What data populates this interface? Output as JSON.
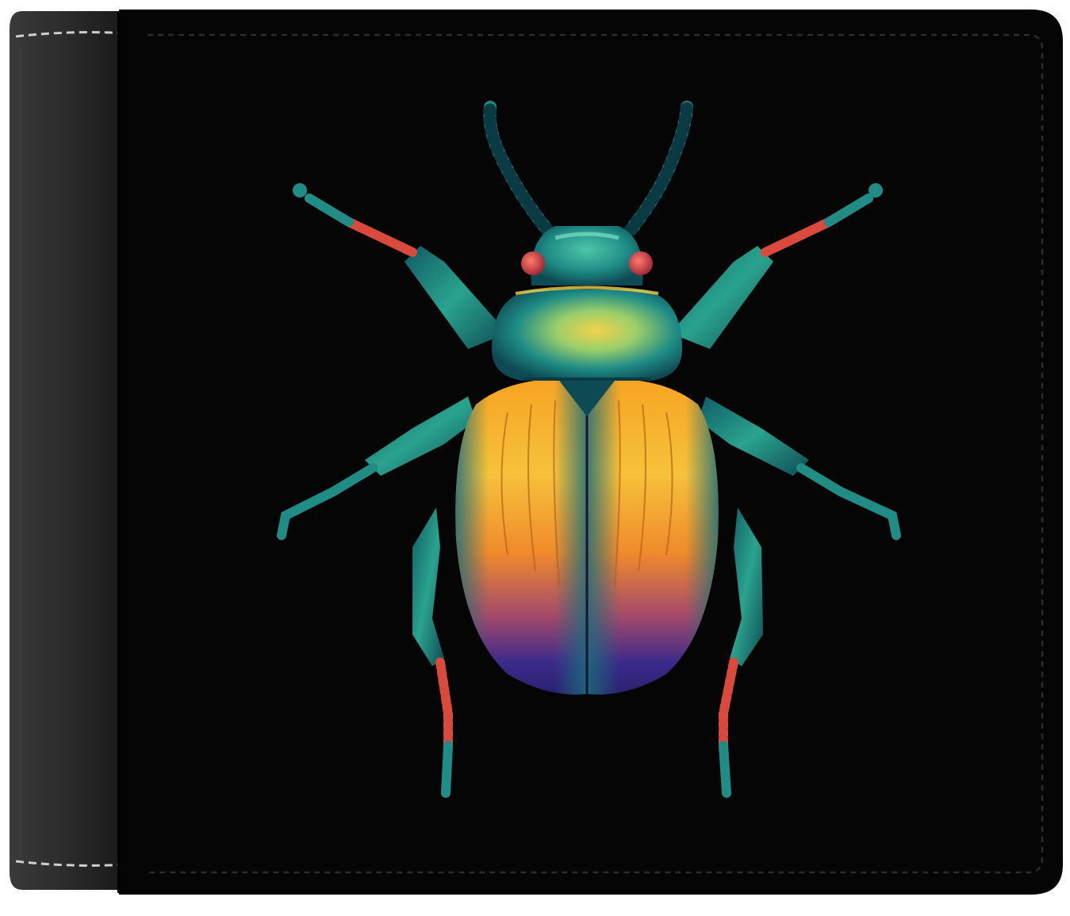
{
  "scene": {
    "subject": "bifold-leather-wallet",
    "print": "iridescent-beetle",
    "colors": {
      "background": "#ffffff",
      "wallet_black": "#050505",
      "spine_leather": "#2a2a2a",
      "stitch": "#cfcfcf",
      "teal": "#1f8c86",
      "teal_dark": "#0e4a54",
      "gold": "#f4b526",
      "orange": "#e77a22",
      "indigo": "#3b2a8a",
      "red": "#d9493c"
    }
  }
}
